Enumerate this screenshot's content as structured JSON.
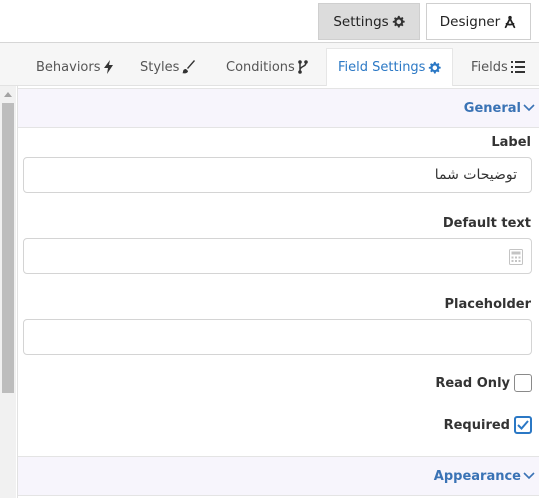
{
  "top_buttons": {
    "settings_label": "Settings",
    "designer_label": "Designer"
  },
  "tabs": [
    {
      "label": "Behaviors",
      "icon": "bolt-icon"
    },
    {
      "label": "Styles",
      "icon": "brush-icon"
    },
    {
      "label": "Conditions",
      "icon": "branch-icon"
    },
    {
      "label": "Field Settings",
      "icon": "gear-icon",
      "active": true
    },
    {
      "label": "Fields",
      "icon": "list-icon"
    }
  ],
  "sections": {
    "general": "General",
    "appearance": "Appearance"
  },
  "fields": {
    "label": {
      "title": "Label",
      "value": "توضیحات شما"
    },
    "default_text": {
      "title": "Default text",
      "value": ""
    },
    "placeholder": {
      "title": "Placeholder",
      "value": ""
    }
  },
  "checks": {
    "read_only": {
      "label": "Read Only",
      "checked": false
    },
    "required": {
      "label": "Required",
      "checked": true
    }
  },
  "colors": {
    "accent": "#2b78c5",
    "section_bg": "#f7f5fc",
    "active_mode_bg": "#dcdcdc"
  }
}
